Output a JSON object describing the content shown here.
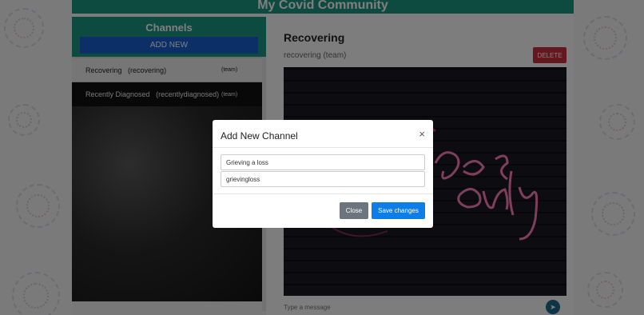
{
  "header": {
    "title": "My Covid Community"
  },
  "sidebar": {
    "title": "Channels",
    "add_label": "ADD NEW",
    "channels": [
      {
        "name": "Recovering",
        "slug": "(recovering)",
        "tag": "(team)"
      },
      {
        "name": "Recently Diagnosed",
        "slug": "(recentlydiagnosed)",
        "tag": "(team)"
      }
    ]
  },
  "main": {
    "channel_title": "Recovering",
    "channel_sub": "recovering (team)",
    "delete_label": "DELETE",
    "message_placeholder": "Type a message",
    "send_icon": "send-icon"
  },
  "modal": {
    "title": "Add New Channel",
    "close_symbol": "×",
    "name_value": "Grieving a loss",
    "slug_value": "grievingloss",
    "close_label": "Close",
    "save_label": "Save changes"
  },
  "colors": {
    "brand": "#1a9480",
    "add_button": "#1a5fd0",
    "delete": "#c82f3e",
    "save": "#0d7dea",
    "close": "#6c757d"
  }
}
